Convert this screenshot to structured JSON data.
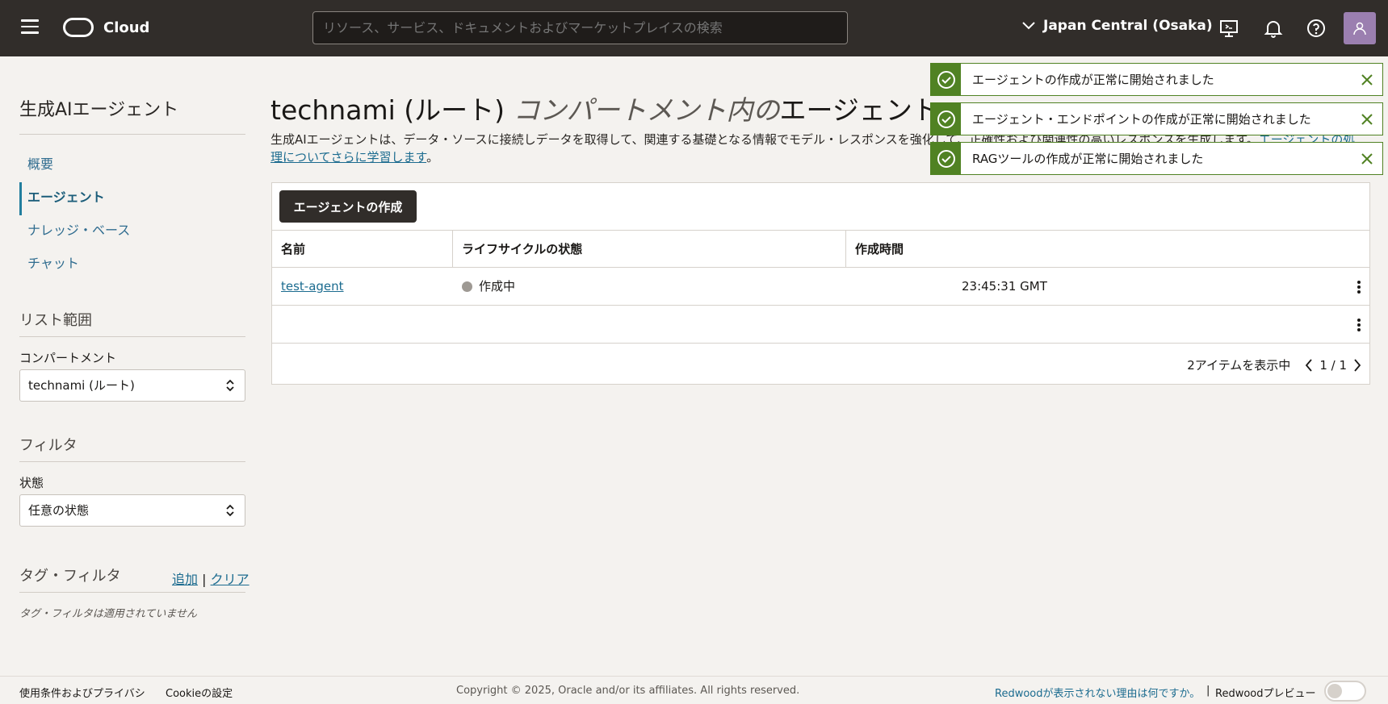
{
  "topbar": {
    "brand": "Cloud",
    "search_placeholder": "リソース、サービス、ドキュメントおよびマーケットプレイスの検索",
    "region": "Japan Central (Osaka)"
  },
  "sidebar": {
    "title": "生成AIエージェント",
    "nav": [
      {
        "label": "概要"
      },
      {
        "label": "エージェント"
      },
      {
        "label": "ナレッジ・ベース"
      },
      {
        "label": "チャット"
      }
    ],
    "scope_title": "リスト範囲",
    "compartment_label": "コンパートメント",
    "compartment_value": "technami (ルート)",
    "filter_title": "フィルタ",
    "state_label": "状態",
    "state_value": "任意の状態",
    "tag_filter_title": "タグ・フィルタ",
    "tag_add": "追加",
    "tag_sep": "|",
    "tag_clear": "クリア",
    "tag_empty": "タグ・フィルタは適用されていません"
  },
  "main": {
    "title_prefix": "technami (ルート)",
    "title_italic": " コンパートメント内の",
    "title_suffix": "エージェント",
    "description": "生成AIエージェントは、データ・ソースに接続しデータを取得して、関連する基礎となる情報でモデル・レスポンスを強化して、正確性および関連性の高いレスポンスを生成します。",
    "description_link": "エージェントの処理についてさらに学習します",
    "description_end": "。",
    "create_button": "エージェントの作成",
    "columns": [
      "名前",
      "ライフサイクルの状態",
      "作成時間"
    ],
    "rows": [
      {
        "name": "test-agent",
        "state": "作成中",
        "created": "23:45:31 GMT"
      }
    ],
    "pager_count": "2アイテムを表示中",
    "pager_page": "1 / 1"
  },
  "toasts": [
    "エージェントの作成が正常に開始されました",
    "エージェント・エンドポイントの作成が正常に開始されました",
    "RAGツールの作成が正常に開始されました"
  ],
  "footer": {
    "terms": "使用条件およびプライバシ",
    "cookies": "Cookieの設定",
    "copyright": "Copyright © 2025, Oracle and/or its affiliates. All rights reserved.",
    "redwood_why": "Redwoodが表示されない理由は何ですか。",
    "sep": "|",
    "redwood_preview": "Redwoodプレビュー"
  },
  "colors": {
    "topbar": "#312d2a",
    "link": "#1b6b8f",
    "success": "#508223"
  }
}
